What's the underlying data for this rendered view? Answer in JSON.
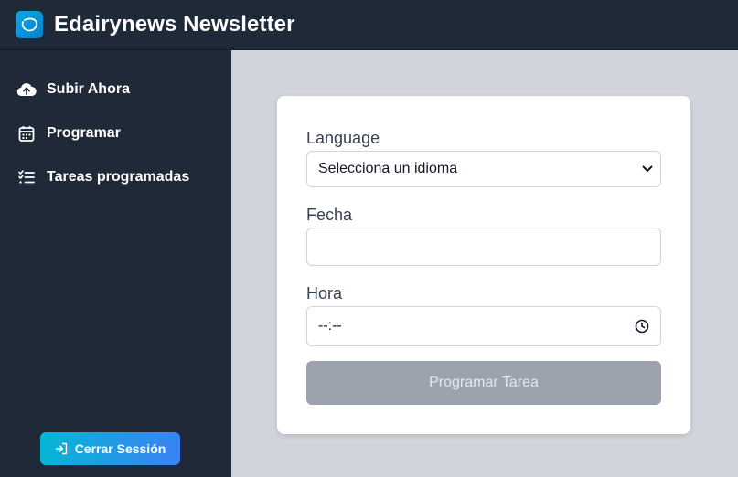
{
  "header": {
    "logo_icon": "edairy-logo-icon",
    "title": "Edairynews Newsletter"
  },
  "sidebar": {
    "items": [
      {
        "label": "Subir Ahora",
        "icon": "cloud-upload-icon"
      },
      {
        "label": "Programar",
        "icon": "calendar-icon"
      },
      {
        "label": "Tareas programadas",
        "icon": "list-check-icon"
      }
    ],
    "logout_label": "Cerrar Sessión",
    "logout_icon": "sign-out-icon"
  },
  "form": {
    "language_label": "Language",
    "language_value": "Selecciona un idioma",
    "date_label": "Fecha",
    "date_value": "",
    "time_label": "Hora",
    "time_value": "--:--",
    "submit_label": "Programar Tarea"
  },
  "colors": {
    "sidebar_bg": "#1f2937",
    "content_bg": "#d1d5db",
    "button_gradient_start": "#06b6d4",
    "button_gradient_end": "#3b82f6",
    "disabled_button": "#9ca3af"
  }
}
